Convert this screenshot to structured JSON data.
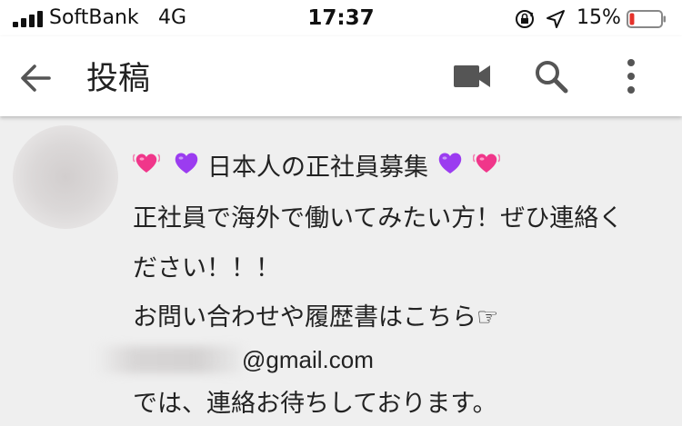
{
  "status_bar": {
    "carrier": "SoftBank",
    "network": "4G",
    "time": "17:37",
    "battery_percent": "15%",
    "battery_level": 0.15,
    "battery_color": "#e5322b"
  },
  "app_bar": {
    "title": "投稿",
    "icons": [
      "back-arrow-icon",
      "video-camera-icon",
      "search-icon",
      "more-vertical-icon"
    ]
  },
  "post": {
    "title": "日本人の正社員募集",
    "title_decorations": [
      "sparkling-heart-icon",
      "purple-heart-icon",
      "purple-heart-icon",
      "sparkling-heart-icon"
    ],
    "line1": "正社員で海外で働いてみたい方！ぜひ連絡く",
    "line2": "ださい！！！",
    "line3": "お問い合わせや履歴書はこちら☞",
    "email_domain": "@gmail.com",
    "line5": "では、連絡お待ちしております。"
  },
  "colors": {
    "background": "#efefef",
    "bar": "#ffffff",
    "icon": "#555555",
    "pink_heart": "#f0368a",
    "purple_heart": "#9b3cf0"
  }
}
